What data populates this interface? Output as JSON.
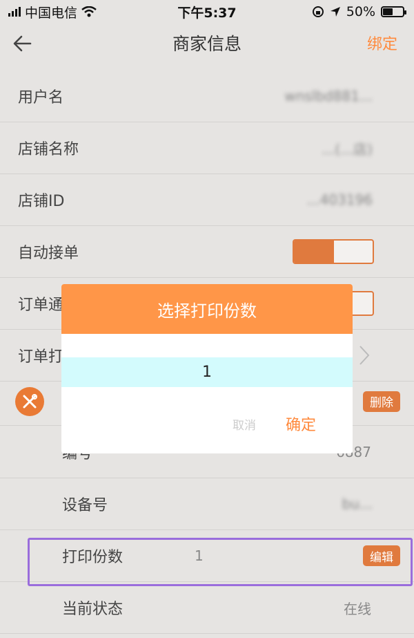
{
  "status_bar": {
    "carrier": "中国电信",
    "time": "下午5:37",
    "battery": "50%",
    "battery_level": 0.5
  },
  "nav": {
    "title": "商家信息",
    "action": "绑定"
  },
  "fields": {
    "username_label": "用户名",
    "username_value": "wnslbd881...",
    "store_name_label": "店铺名称",
    "store_name_value": "...(...店)",
    "store_id_label": "店铺ID",
    "store_id_value": "...403196",
    "auto_accept_label": "自动接单",
    "order_notify_label": "订单通",
    "order_print_label": "订单打"
  },
  "device": {
    "delete_label": "删除",
    "number_label": "编号",
    "number_value": "6887",
    "device_no_label": "设备号",
    "device_no_value": "bu...",
    "print_copies_label": "打印份数",
    "print_copies_value": "1",
    "edit_label": "编辑",
    "status_label": "当前状态",
    "status_value": "在线"
  },
  "dialog": {
    "title": "选择打印份数",
    "selected": "1",
    "cancel": "取消",
    "confirm": "确定"
  },
  "colors": {
    "accent": "#ff8a3d",
    "dialog_header": "#ff9648",
    "picker_highlight": "#d3fbfd",
    "annotation_border": "#9a6ddc"
  },
  "icons": [
    "back-arrow-icon",
    "wifi-icon",
    "lock-rotation-icon",
    "location-icon",
    "battery-icon",
    "chevron-right-icon",
    "tools-icon"
  ]
}
